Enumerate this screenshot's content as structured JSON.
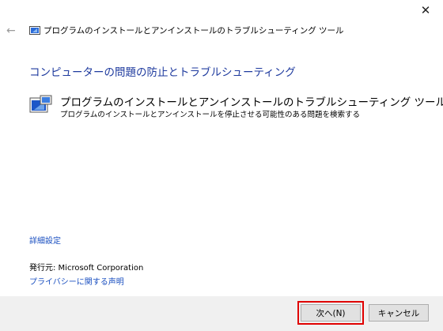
{
  "window": {
    "title": "プログラムのインストールとアンインストールのトラブルシューティング ツール",
    "close_glyph": "✕",
    "back_glyph": "←"
  },
  "main": {
    "heading": "コンピューターの問題の防止とトラブルシューティング",
    "tool": {
      "name": "プログラムのインストールとアンインストールのトラブルシューティング ツール",
      "description": "プログラムのインストールとアンインストールを停止させる可能性のある問題を検索する",
      "icon": "troubleshooter-icon"
    },
    "advanced_link": "詳細設定",
    "publisher": "発行元:  Microsoft Corporation",
    "privacy_link": "プライバシーに関する声明"
  },
  "footer": {
    "next_label": "次へ(N)",
    "cancel_label": "キャンセル"
  },
  "colors": {
    "heading": "#1e3a9e",
    "link": "#1a4fc0",
    "highlight": "#e00000",
    "footer_bg": "#f0f0f0"
  }
}
